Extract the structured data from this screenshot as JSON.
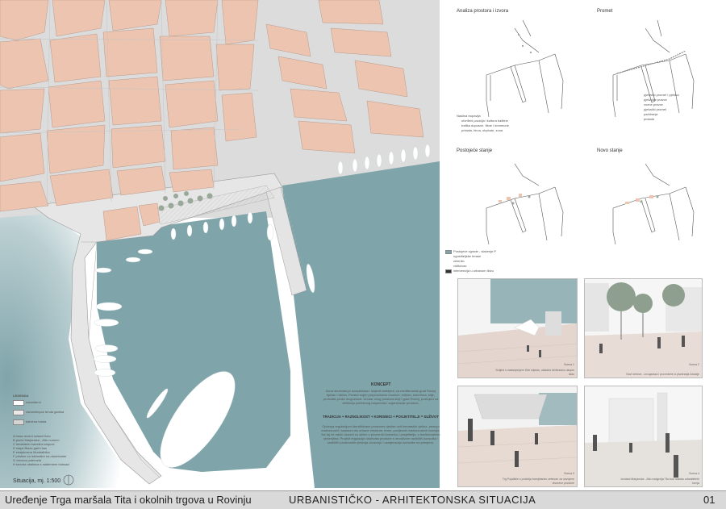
{
  "footer": {
    "title": "Uređenje Trga maršala Tita i okolnih trgova u Rovinju",
    "subtitle": "URBANISTIČKO - ARHITEKTONSKA SITUACIJA",
    "page": "01"
  },
  "situation": {
    "scale_label": "Situacija, mj. 1:500"
  },
  "legend": {
    "title": "LEGENDA",
    "items": [
      {
        "label": "nanošterni"
      },
      {
        "label": "zamamtopos tenda gadina"
      },
      {
        "label": "kamena trasta"
      }
    ],
    "keys": [
      "A   trasa recent uzlazni liuto",
      "B   ploča Marjanska - Alto numnm",
      "C   tekstlaktin kanelimi stupovi",
      "D   stajal Blaža garhi bas",
      "E   strajskosna Munbalhika",
      "F   pristine za iskhostire na obomtomie",
      "G   obnova potemela",
      "H   toborta obalnica s nadlemem boksaci"
    ]
  },
  "concept": {
    "heading": "KONCEPT",
    "paragraph1": "Zona obuhvata je kompleksan i slojevit ambijent, za mediteranski grad Rovinj tipičan i sličan. Prostor kojim preporučamo mostom, reiblan, kotorrima, bilje, pruhvata pruža mogućnost. Unutar ovog prostora stoji i grad Rovinj, postojeći za definiciju potrebnog rasporeda i organizacije prostora.",
    "tagline": "TRADICIJA + RAZNOLIKOST + KORISNICI + POSJETITELJI = SUŽIVOT",
    "paragraph2": "Općenja regulacijom identificirane prostorne rješine ovih tematskih cjelina, pristupi tradicionalni i sastavni dio urbane strukture, teme, povijesnih tradicionalnih nazivlja. Na taj ne način ulazeći su slične u poveznici korisnika i posjetitelja, s tradicionalnim rješenjima. Projekt regulacije obuhvata prostore s mnoštvom različitih korisnika i različitih prostorskih rješenja dovezuju i usmjeravaju korisnike na primjenu."
  },
  "diagrams": [
    {
      "title": "Analiza prostora i izvora"
    },
    {
      "title": "Promet"
    },
    {
      "title": "Postojeće stanje"
    },
    {
      "title": "Novo stanje"
    }
  ],
  "diagram_legends": {
    "analysis": [
      "Nasilna trupavija",
      "utvrđeni pozicija i kultura baštine",
      "trafika dopusne, fikne i dommune",
      "pristala, hirva, obplude, zona"
    ],
    "traffic": [
      "pješački promet / pješaci",
      "pješačke pravce",
      "vozne pravce",
      "pješački promet",
      "parkiranje",
      "pristala"
    ],
    "existing": [
      "Postojeće zgrade - slaženje P",
      "ugostiteljske terase",
      "zelenilo",
      "vidikovac",
      "intervencija u urbanom tkivu"
    ]
  },
  "renders": [
    {
      "caption_title": "Scena 1",
      "caption": "Srdjeni s nastanjenjem Srbi mijesto, ukladne Arbitrastvo ukupni izlaz"
    },
    {
      "caption_title": "Scena 2",
      "caption": "Novi šetnice - izvugaraza i provedene iz planiranja lokacije"
    },
    {
      "caption_title": "Scena 3",
      "caption": "Trg Pojališče s pročelja tramjetanim zelenom za osvojene otvorene prostore"
    },
    {
      "caption_title": "Scena 4",
      "caption": "Izvidani Marjanske - Alto nadgrolja Tito kod izlaska urbanitetnih tornja"
    }
  ],
  "colors": {
    "sea": "#7fa4aa",
    "roof": "#ecc4b0",
    "street": "#d7d7d7",
    "footer": "#d9d9d9"
  }
}
